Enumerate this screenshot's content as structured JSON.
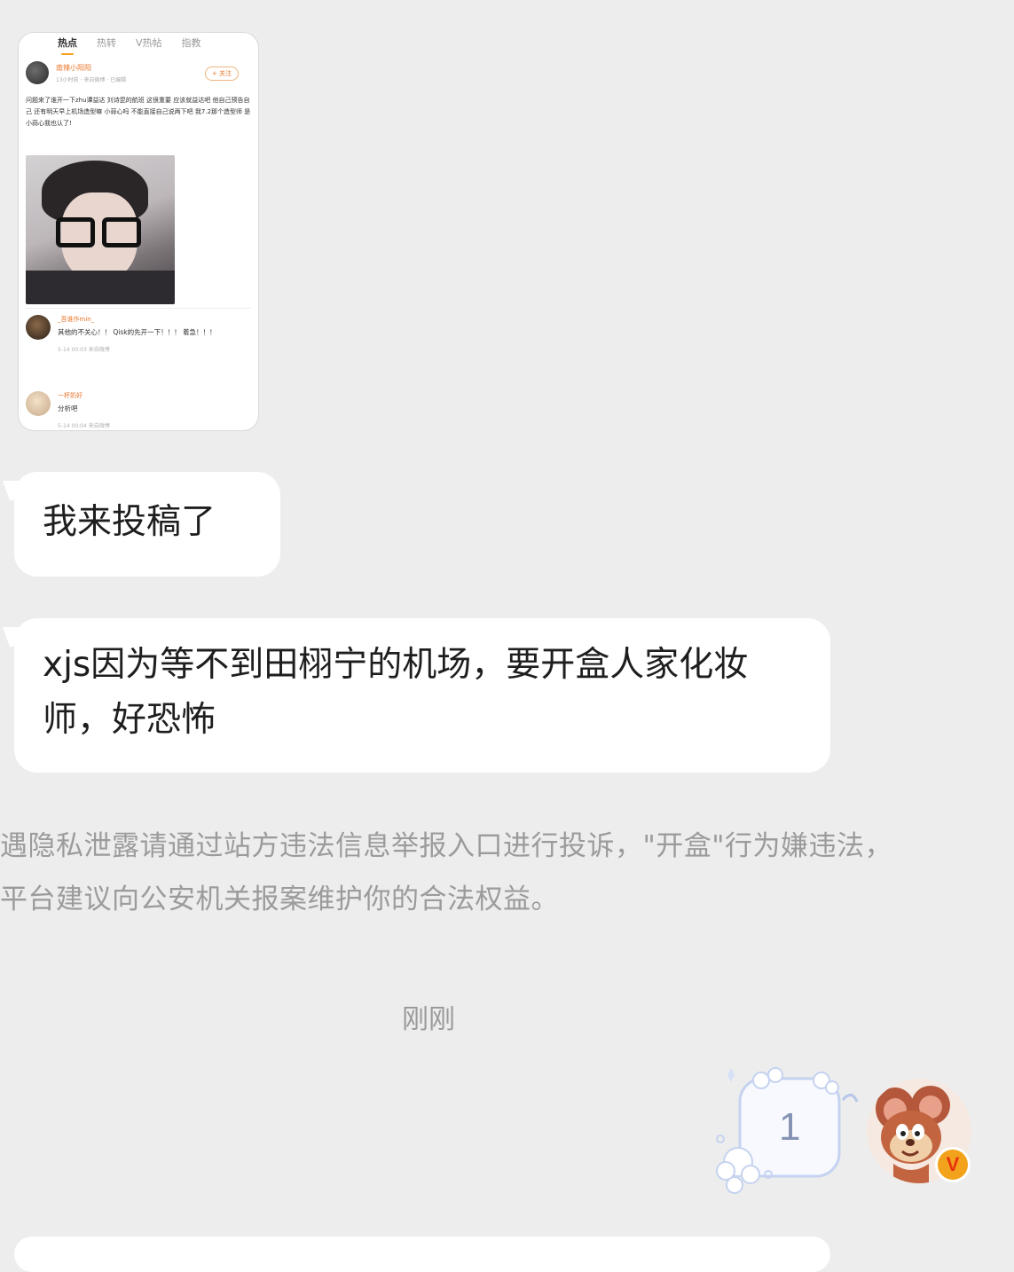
{
  "thumbnail": {
    "tabs": [
      "热点",
      "热转",
      "V热帖",
      "指教"
    ],
    "username": "南辣小阳阳",
    "user_meta": "13小时前 · 来自微博 · 已编辑",
    "follow_label": "+ 关注",
    "post_text": "问题来了谁开一下zhu谭益达 刘诗昆的航班 这很重要 应该就益达吧 他自己预告自己 还有明天早上机场造型嘛 小蒜心吗 不能直接自己说两下吧 我7.2那个造型师 是小蒜心我也认了!",
    "comment1_name": "_吾谁作min_",
    "comment1_text": "其他的不关心！！ Qisk的先开一下！！！ 着急！！！",
    "comment1_meta": "5-14 00:03 来自微博",
    "comment2_name": "一杯奶好",
    "comment2_text": "分析吧",
    "comment2_meta": "5-14 00:04 来自微博"
  },
  "messages": [
    {
      "text": "我来投稿了"
    },
    {
      "text": "xjs因为等不到田栩宁的机场，要开盒人家化妆师，好恐怖"
    }
  ],
  "system_notice": "遇隐私泄露请通过站方违法信息举报入口进行投诉，\"开盒\"行为嫌违法，平台建议向公安机关报案维护你的合法权益。",
  "timestamp": "刚刚",
  "sent_sticker": {
    "number": "1"
  },
  "avatar_badge": "V",
  "colors": {
    "background": "#ededed",
    "bubble": "#ffffff",
    "notice_text": "#9b9b9b",
    "badge": "#f3a21b"
  }
}
